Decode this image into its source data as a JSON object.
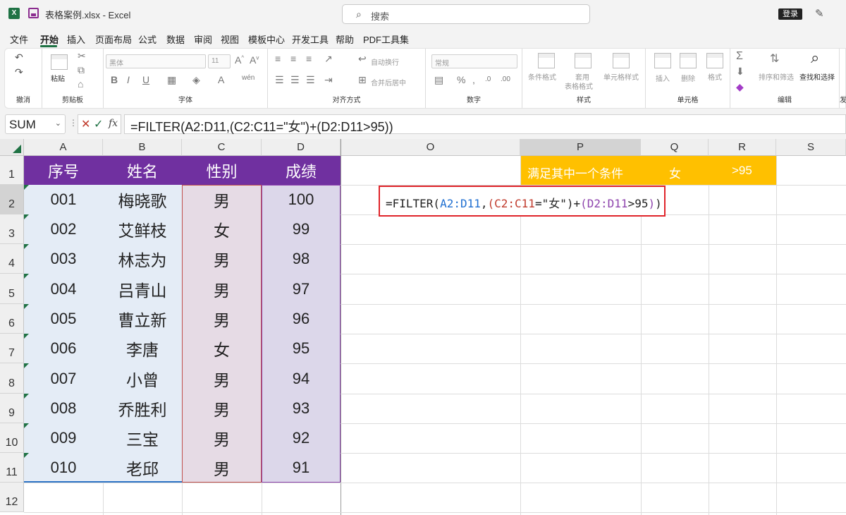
{
  "window": {
    "file_title": "表格案例.xlsx  -  Excel",
    "search_placeholder": "搜索",
    "login_label": "登录"
  },
  "tabs": [
    "文件",
    "开始",
    "插入",
    "页面布局",
    "公式",
    "数据",
    "审阅",
    "视图",
    "模板中心",
    "开发工具",
    "帮助",
    "PDF工具集"
  ],
  "active_tab": "开始",
  "ribbon": {
    "groups": {
      "undo": "撤消",
      "clipboard": "剪贴板",
      "font": "字体",
      "alignment": "对齐方式",
      "number": "数字",
      "styles": "样式",
      "cells": "单元格",
      "editing": "编辑",
      "extra": "发"
    },
    "paste_label": "粘贴",
    "font_name": "黑体",
    "font_size": "11",
    "wrap_text": "自动换行",
    "merge_center": "合并后居中",
    "number_format": "常规",
    "conditional_format": "条件格式",
    "table_format_1": "套用",
    "table_format_2": "表格格式",
    "cell_styles": "单元格样式",
    "insert": "插入",
    "delete": "删除",
    "format": "格式",
    "sort_filter": "排序和筛选",
    "find_select": "查找和选择"
  },
  "formula_bar": {
    "name_box": "SUM",
    "formula": "=FILTER(A2:D11,(C2:C11=\"女\")+(D2:D11>95))"
  },
  "columns": [
    "A",
    "B",
    "C",
    "D",
    "O",
    "P",
    "Q",
    "R",
    "S"
  ],
  "rows": [
    "1",
    "2",
    "3",
    "4",
    "5",
    "6",
    "7",
    "8",
    "9",
    "10",
    "11",
    "12"
  ],
  "table": {
    "headers": [
      "序号",
      "姓名",
      "性别",
      "成绩"
    ],
    "rows": [
      [
        "001",
        "梅晓歌",
        "男",
        "100"
      ],
      [
        "002",
        "艾鲜枝",
        "女",
        "99"
      ],
      [
        "003",
        "林志为",
        "男",
        "98"
      ],
      [
        "004",
        "吕青山",
        "男",
        "97"
      ],
      [
        "005",
        "曹立新",
        "男",
        "96"
      ],
      [
        "006",
        "李唐",
        "女",
        "95"
      ],
      [
        "007",
        "小曾",
        "男",
        "94"
      ],
      [
        "008",
        "乔胜利",
        "男",
        "93"
      ],
      [
        "009",
        "三宝",
        "男",
        "92"
      ],
      [
        "010",
        "老邱",
        "男",
        "91"
      ]
    ]
  },
  "condition": {
    "label": "满足其中一个条件",
    "gender": "女",
    "score": ">95"
  },
  "formula_cell": {
    "p1": "=FILTER(",
    "p2": "A2:D11",
    "p3": ",",
    "p4": "(",
    "p5": "C2:C11",
    "p6": "=\"女\")",
    "p7": "+",
    "p8": "(",
    "p9": "D2:D11",
    "p10": ">95",
    "p11": ")",
    "p12": ")"
  },
  "colors": {
    "header_purple": "#7030a0",
    "condition_gold": "#ffc000",
    "excel_green": "#1f7244",
    "ref_blue": "#1f6fd1",
    "ref_red": "#c0392b",
    "ref_purple": "#8e44ad"
  }
}
